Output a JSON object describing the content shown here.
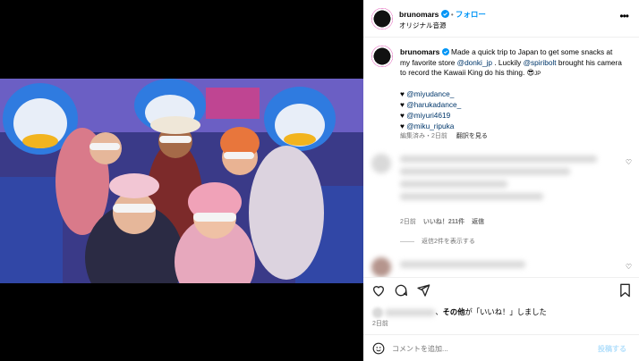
{
  "post": {
    "username": "brunomars",
    "follow_label": "フォロー",
    "audio_label": "オリジナル音源",
    "caption": {
      "text_before": "Made a quick trip to Japan to get some snacks at my favorite store ",
      "mention_1": "@donki_jp",
      "text_middle": " . Luckily ",
      "mention_2": "@spiribolt",
      "text_after": " brought his camera to record the Kawaii King do his thing. 😎",
      "flag": "JP"
    },
    "tags": [
      "@miyudance_",
      "@harukadance_",
      "@miyuri4619",
      "@miku_ripuka"
    ],
    "tag_prefix": "♥",
    "edited_label": "編集済み・2日前",
    "translate_label": "翻訳を見る"
  },
  "comments": {
    "reply_meta": {
      "time": "2日前",
      "likes": "いいね！211件",
      "reply": "返信"
    },
    "show_replies": "返信2件を表示する"
  },
  "footer": {
    "likes_suffix_bold": "その他",
    "likes_suffix": "が「いいね！」しました",
    "likes_separator": "、",
    "posted_ago": "2日前",
    "comment_placeholder": "コメントを追加...",
    "post_button": "投稿する"
  },
  "colors": {
    "link": "#00376b",
    "accent": "#0095f6",
    "muted": "#737373"
  },
  "icons": [
    "verified-badge-icon",
    "more-options-icon",
    "heart-icon",
    "comment-icon",
    "share-icon",
    "bookmark-icon",
    "emoji-icon",
    "speaker-icon"
  ]
}
